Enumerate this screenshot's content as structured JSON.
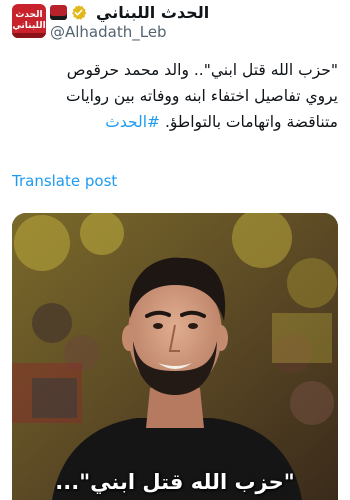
{
  "account": {
    "avatar_text_line1": "الحدث",
    "avatar_text_line2": "اللبناني",
    "display_name": "الحدث اللبناني",
    "handle": "@Alhadath_Leb"
  },
  "tweet": {
    "line1": "\"حزب الله قتل ابني\".. والد محمد حرقوص",
    "line2": "يروي تفاصيل اختفاء ابنه ووفاته بين روايات",
    "line3_text": "متناقضة واتهامات بالتواطؤ.",
    "hashtag": "#الحدث"
  },
  "translate_label": "Translate post",
  "media": {
    "caption": "\"حزب الله قتل ابني\"..."
  },
  "colors": {
    "link": "#1d9bf0",
    "text": "#0f1419",
    "muted": "#536471",
    "brand_red": "#c8232c"
  }
}
